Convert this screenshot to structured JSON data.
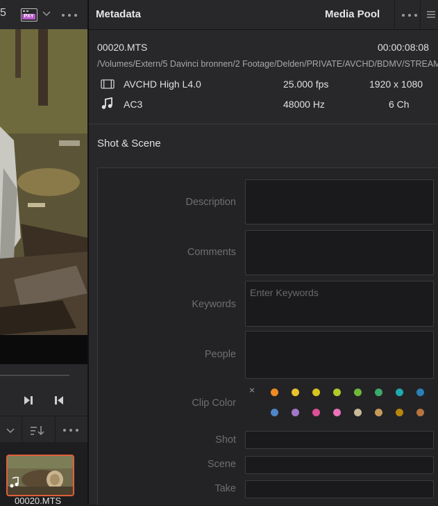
{
  "left_panel": {
    "header": {
      "cut_text": "5",
      "pxy_label": "PXY"
    },
    "thumbnail": {
      "caption": "00020.MTS"
    }
  },
  "metadata_panel": {
    "title": "Metadata",
    "media_pool_label": "Media Pool",
    "clip": {
      "name": "00020.MTS",
      "duration": "00:00:08:08",
      "path": "/Volumes/Extern/5 Davinci bronnen/2 Footage/Delden/PRIVATE/AVCHD/BDMV/STREAM",
      "video": {
        "codec": "AVCHD High L4.0",
        "fps": "25.000 fps",
        "resolution": "1920 x 1080"
      },
      "audio": {
        "codec": "AC3",
        "rate": "48000 Hz",
        "channels": "6 Ch"
      }
    },
    "section_title": "Shot & Scene",
    "fields": {
      "description_label": "Description",
      "comments_label": "Comments",
      "keywords_label": "Keywords",
      "keywords_placeholder": "Enter Keywords",
      "people_label": "People",
      "clip_color_label": "Clip Color",
      "clip_color_clear": "×",
      "shot_label": "Shot",
      "scene_label": "Scene",
      "take_label": "Take"
    },
    "clip_colors_row1": [
      "#f08a24",
      "#e8c22c",
      "#d9c31e",
      "#b3c92a",
      "#6fb63a",
      "#3da86d",
      "#1faab0",
      "#2a7fb6"
    ],
    "clip_colors_row2": [
      "#4f86c6",
      "#a277c8",
      "#dc4f95",
      "#ec72b8",
      "#c9b89a",
      "#c69a5a",
      "#b8860b",
      "#b8743e"
    ]
  },
  "icons": [
    "proxy-badge-icon",
    "chevron-down-icon",
    "more-icon",
    "play-to-end-icon",
    "go-to-start-icon",
    "sort-icon",
    "film-icon",
    "music-note-icon",
    "list-icon",
    "clear-icon"
  ]
}
